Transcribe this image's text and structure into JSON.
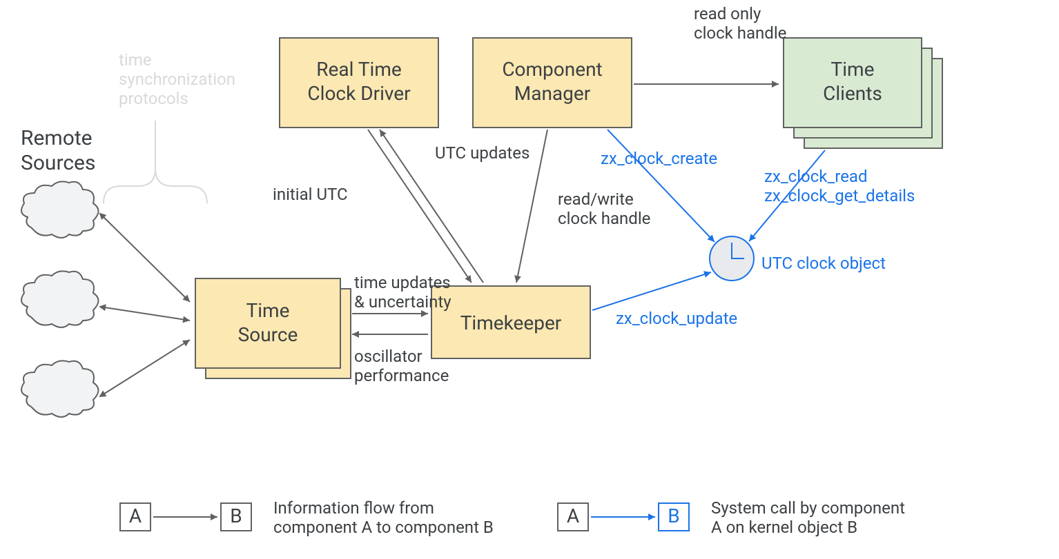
{
  "clouds_label_1": "Remote",
  "clouds_label_2": "Sources",
  "sync_label_1": "time",
  "sync_label_2": "synchronization",
  "sync_label_3": "protocols",
  "boxes": {
    "rtc_driver_1": "Real Time",
    "rtc_driver_2": "Clock Driver",
    "component_manager_1": "Component",
    "component_manager_2": "Manager",
    "time_clients_1": "Time",
    "time_clients_2": "Clients",
    "time_source_1": "Time",
    "time_source_2": "Source",
    "timekeeper": "Timekeeper"
  },
  "labels": {
    "initial_utc": "initial UTC",
    "utc_updates": "UTC updates",
    "time_updates_1": "time updates",
    "time_updates_2": "& uncertainty",
    "osc_perf_1": "oscillator",
    "osc_perf_2": "performance",
    "readwrite_1": "read/write",
    "readwrite_2": "clock handle",
    "readonly_1": "read only",
    "readonly_2": "clock handle",
    "zx_clock_create": "zx_clock_create",
    "zx_clock_read": "zx_clock_read",
    "zx_clock_get_details": "zx_clock_get_details",
    "zx_clock_update": "zx_clock_update",
    "utc_clock_object": "UTC clock object"
  },
  "legend": {
    "a": "A",
    "b": "B",
    "info_1": "Information flow from",
    "info_2": "component A to component B",
    "sys_1": "System call by component",
    "sys_2": "A on kernel object B"
  },
  "colors": {
    "box_fill": "#fce8b2",
    "green_fill": "#d9ead3",
    "stroke": "#616161",
    "blue": "#1a73e8",
    "faint": "#d9d9d9",
    "clock_fill": "#e8eaed"
  }
}
